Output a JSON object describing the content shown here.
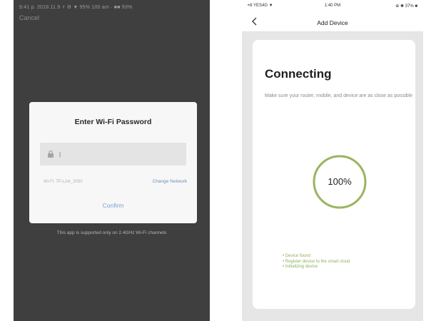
{
  "left_screen": {
    "status_bar": "9:41 p. 2018.11.9  ⚡ ⚙ ▼ 95% 100 am · ■■ 93%",
    "cancel_label": "Cancel",
    "dialog": {
      "title": "Enter Wi-Fi Password",
      "password_placeholder": "|",
      "wifi_name": "Wi-Fi: TP-Link_3030",
      "change_network_label": "Change Network",
      "confirm_label": "Confirm"
    },
    "footnote": "This app is supported only on 2.4GHz Wi-Fi channels"
  },
  "right_screen": {
    "status_bar": {
      "left": "•ıll YES4G ▼",
      "time": "1:40 PM",
      "right": "⊕ ✱ 37% ■"
    },
    "nav": {
      "title": "Add Device"
    },
    "card": {
      "title": "Connecting",
      "description": "Make sure your router, mobile, and device are as close as possible",
      "progress_label": "100%",
      "progress_value": 1.0,
      "steps": [
        "• Device found",
        "• Register device to the smart cloud",
        "• Initializing device"
      ]
    },
    "colors": {
      "accent_green": "#9ab560",
      "step_green": "#8db05e",
      "link_blue": "#6f8fb8"
    }
  }
}
